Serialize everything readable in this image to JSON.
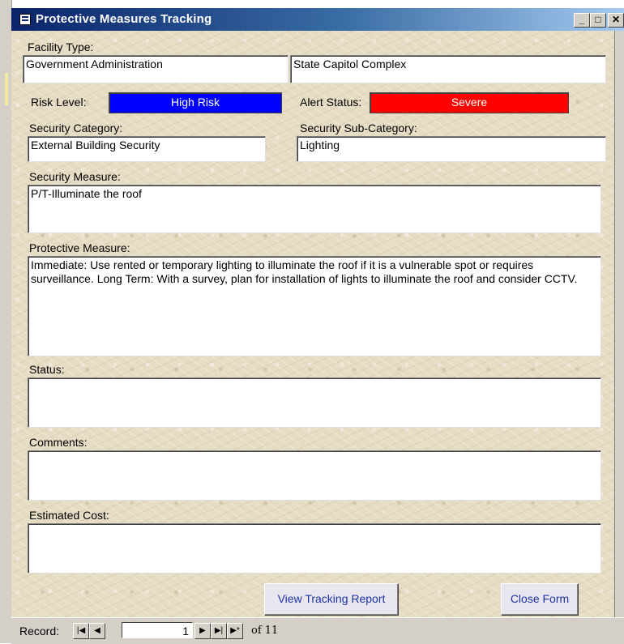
{
  "window": {
    "title": "Protective Measures Tracking",
    "controls": {
      "minimize": "_",
      "maximize": "□",
      "close": "✕"
    }
  },
  "form": {
    "facility_type_label": "Facility Type:",
    "facility_type_value": "Government Administration",
    "facility_name_value": "State Capitol Complex",
    "risk_level_label": "Risk Level:",
    "risk_level_value": "High Risk",
    "risk_level_color": "#0000ff",
    "alert_status_label": "Alert Status:",
    "alert_status_value": "Severe",
    "alert_status_color": "#ff0000",
    "security_category_label": "Security Category:",
    "security_category_value": "External Building Security",
    "security_subcategory_label": "Security Sub-Category:",
    "security_subcategory_value": "Lighting",
    "security_measure_label": "Security Measure:",
    "security_measure_value": "P/T-Illuminate the roof",
    "protective_measure_label": "Protective Measure:",
    "protective_measure_value": "Immediate: Use rented or temporary lighting to illuminate the roof if it is a vulnerable spot or requires surveillance.  Long Term: With a survey, plan for installation of lights to illuminate the roof and consider CCTV.",
    "status_label": "Status:",
    "status_value": "",
    "comments_label": "Comments:",
    "comments_value": "",
    "estimated_cost_label": "Estimated Cost:",
    "estimated_cost_value": "",
    "view_report_button": "View Tracking Report",
    "close_form_button": "Close Form"
  },
  "navigator": {
    "record_label": "Record:",
    "current_record": "1",
    "of_text": "of 11",
    "icons": [
      "first-record-icon",
      "previous-record-icon",
      "next-record-icon",
      "last-record-icon",
      "new-record-icon"
    ]
  }
}
